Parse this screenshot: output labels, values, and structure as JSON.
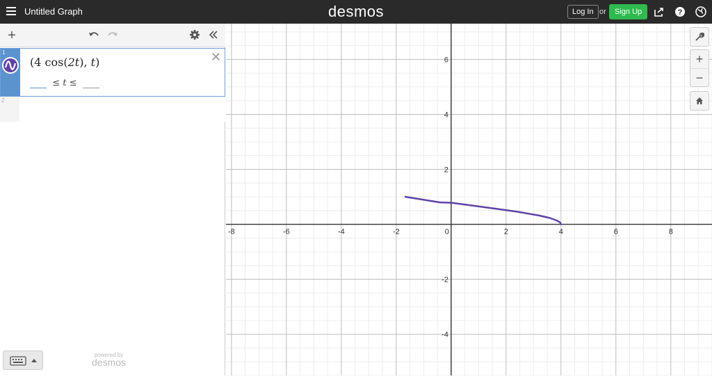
{
  "header": {
    "title": "Untitled Graph",
    "brand": "desmos",
    "login_label": "Log In",
    "or_label": "or",
    "signup_label": "Sign Up"
  },
  "expressions": [
    {
      "index": "1",
      "formula_parts": [
        "(",
        "4",
        "cos",
        "(",
        "2t",
        ")",
        ", ",
        "t",
        ")"
      ],
      "range_min": "",
      "range_var": "t",
      "range_max": "",
      "color": "#6042a6"
    },
    {
      "index": "2"
    }
  ],
  "footer": {
    "powered_small": "powered by",
    "powered_big": "desmos"
  },
  "colors": {
    "curve": "#6042a6",
    "topbar": "#2a2a2a",
    "signup": "#2fba4f",
    "selection": "#5b93cf"
  },
  "icons": {
    "menu": "hamburger-icon",
    "add": "plus-icon",
    "undo": "undo-icon",
    "redo": "redo-icon",
    "settings": "gear-icon",
    "collapse": "double-chevron-left-icon",
    "share": "share-icon",
    "help": "question-icon",
    "language": "globe-icon",
    "wrench": "wrench-icon",
    "zoom_in": "plus-icon",
    "zoom_out": "minus-icon",
    "home": "home-icon",
    "keyboard": "keyboard-icon"
  },
  "chart_data": {
    "type": "line",
    "x_ticks": [
      "-8",
      "-6",
      "-4",
      "-2",
      "0",
      "2",
      "4",
      "6",
      "8"
    ],
    "y_ticks": [
      "6",
      "4",
      "2",
      "-2",
      "-4"
    ],
    "xlim": [
      -8.2,
      9.5
    ],
    "ylim": [
      -5.5,
      7.3
    ],
    "grid": true,
    "series": [
      {
        "x": [
          -1.666,
          -0.416,
          0.0,
          0.8,
          1.6,
          2.4,
          3.2,
          3.6,
          3.84,
          3.92,
          3.98,
          4.0
        ],
        "y": [
          1.0,
          0.8,
          0.785,
          0.68,
          0.57,
          0.46,
          0.32,
          0.23,
          0.14,
          0.1,
          0.05,
          0.0
        ]
      }
    ]
  }
}
